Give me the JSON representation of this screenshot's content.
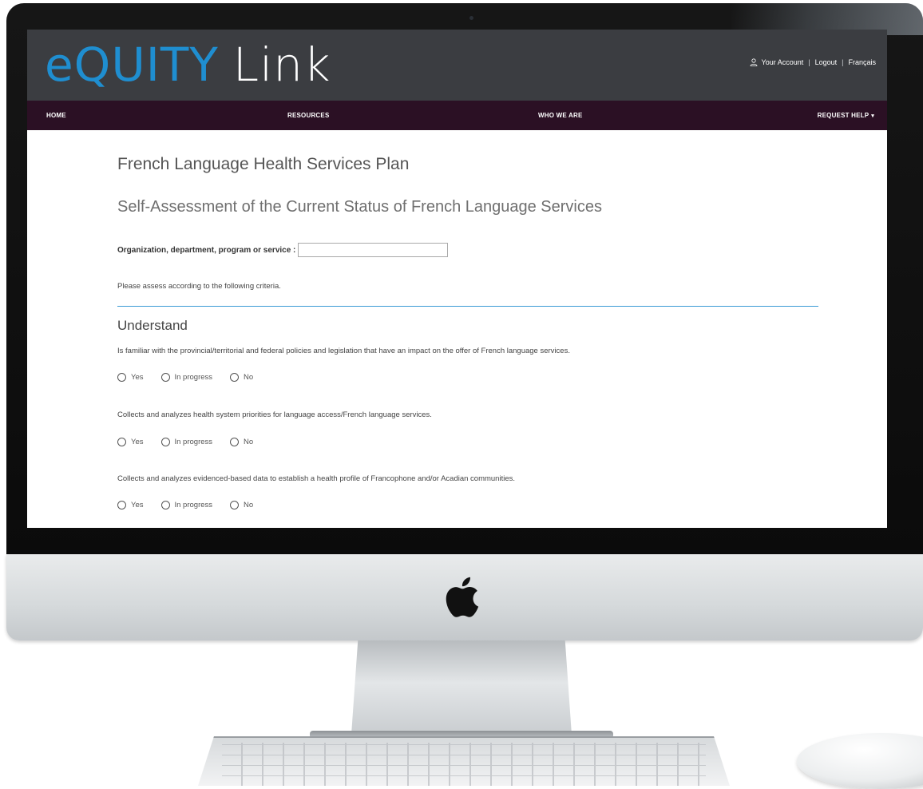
{
  "header": {
    "logo_equity": "eQUITY",
    "logo_link": "Link",
    "account": {
      "your_account": "Your Account",
      "logout": "Logout",
      "language": "Français",
      "separator": "|"
    }
  },
  "nav": {
    "home": "HOME",
    "resources": "RESOURCES",
    "who_we_are": "WHO WE ARE",
    "request_help": "REQUEST HELP",
    "request_help_caret": "▾"
  },
  "main": {
    "title": "French Language Health Services Plan",
    "subtitle": "Self-Assessment of the Current Status of French Language Services",
    "org_field": {
      "label": "Organization, department, program or service :",
      "value": "",
      "placeholder": ""
    },
    "instructions": "Please assess according to the following criteria.",
    "section": {
      "heading": "Understand",
      "questions": [
        {
          "text": "Is familiar with the provincial/territorial and federal policies and legislation that have an impact on the offer of French language services.",
          "options": [
            "Yes",
            "In progress",
            "No"
          ]
        },
        {
          "text": "Collects and analyzes health system priorities for language access/French language services.",
          "options": [
            "Yes",
            "In progress",
            "No"
          ]
        },
        {
          "text": "Collects and analyzes evidenced-based data to establish a health profile of Francophone and/or Acadian communities.",
          "options": [
            "Yes",
            "In progress",
            "No"
          ]
        }
      ]
    }
  },
  "colors": {
    "header_bg": "#3b3d41",
    "nav_bg": "#2b1024",
    "logo_accent": "#1f8ed0",
    "divider": "#3a9ad6"
  },
  "icons": {
    "user": "user-icon",
    "apple": "apple-logo-icon"
  }
}
